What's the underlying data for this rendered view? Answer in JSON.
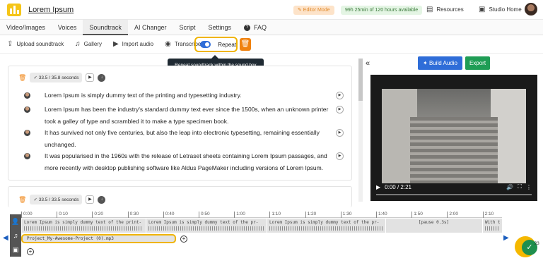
{
  "header": {
    "brand": "Lorem Ipsum",
    "editor_mode": "✎ Editor Mode",
    "time_available": "99h 25min of 120 hours available",
    "resources": "Resources",
    "studio_home": "Studio Home"
  },
  "tabs": [
    {
      "label": "Video/Images"
    },
    {
      "label": "Voices"
    },
    {
      "label": "Soundtrack",
      "active": true
    },
    {
      "label": "AI Changer"
    },
    {
      "label": "Script"
    },
    {
      "label": "Settings"
    },
    {
      "label": "FAQ"
    }
  ],
  "toolbar": {
    "upload": "Upload soundtrack",
    "gallery": "Gallery",
    "import": "Import audio",
    "transcribe": "Transcribe",
    "repeat": "Repeat",
    "tooltip": "Repeat soundtrack within the sound box"
  },
  "cards": [
    {
      "time_badge": "33.5 / 35.8 seconds",
      "paragraphs": [
        "Lorem Ipsum is simply dummy text of the printing and typesetting industry.",
        "Lorem Ipsum has been the industry's standard dummy text ever since the 1500s, when an unknown printer took a galley of type and scrambled it to make a type specimen book.",
        "It has survived not only five centuries, but also the leap into electronic typesetting, remaining essentially unchanged.",
        "It was popularised in the 1960s with the release of Letraset sheets containing Lorem Ipsum passages, and more recently with desktop publishing software like Aldus PageMaker including versions of Lorem Ipsum."
      ]
    },
    {
      "time_badge": "33.5 / 33.5 seconds"
    }
  ],
  "right_panel": {
    "build_audio": "Build Audio",
    "export": "Export",
    "video_time": "0:00 / 2:21",
    "video_progress": 0.0
  },
  "timeline": {
    "ticks": [
      "0:00",
      "0:10",
      "0:20",
      "0:30",
      "0:40",
      "0:50",
      "1:00",
      "1:10",
      "1:20",
      "1:30",
      "1:40",
      "1:50",
      "2:00",
      "2:10"
    ],
    "segments": [
      "Lorem Ipsum is simply dummy text of the print-",
      "Lorem Ipsum is simply dummy text of the pr-",
      "Lorem Ipsum is simply dummy text of the pr-",
      "[pause 0.3s]",
      "With t"
    ],
    "soundtrack_file": "Project_My-Awesome-Project (0).mp3"
  },
  "fab": {
    "count": "23"
  },
  "colors": {
    "accent_blue": "#2f6dd8",
    "export_green": "#1f9d55",
    "highlight_yellow": "#f0b400",
    "orange": "#f0820f"
  }
}
